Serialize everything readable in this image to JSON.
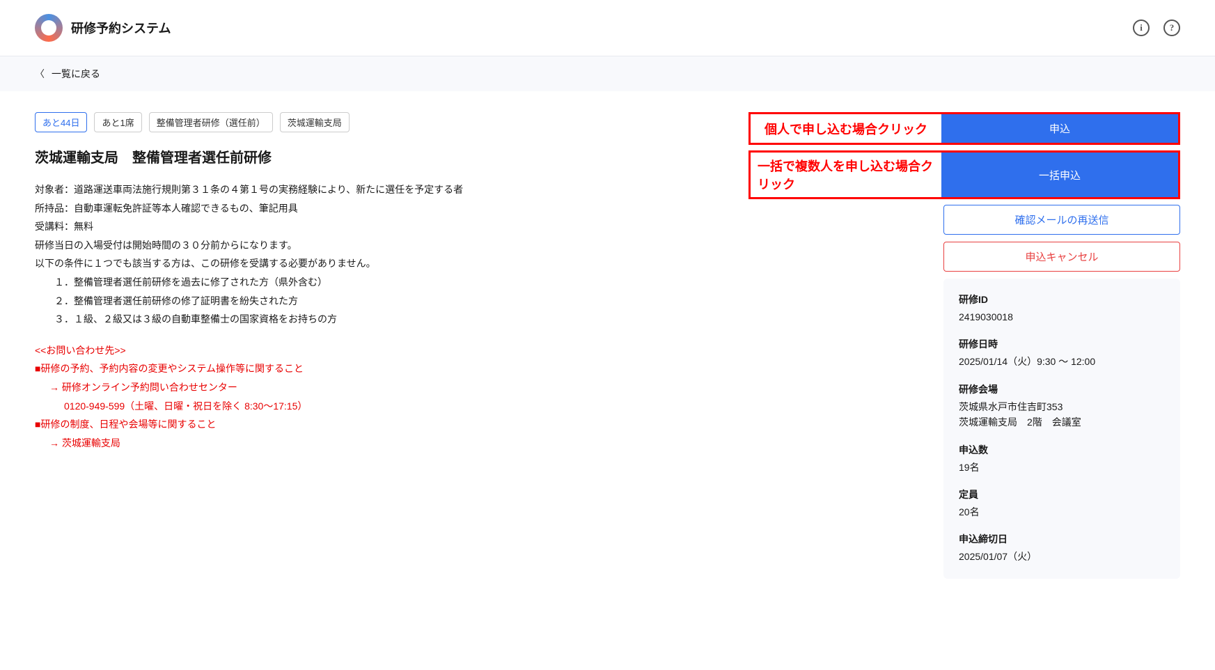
{
  "header": {
    "title": "研修予約システム"
  },
  "back": {
    "label": "一覧に戻る"
  },
  "badges": {
    "days_left": "あと44日",
    "seats_left": "あと1席",
    "category": "整備管理者研修（選任前）",
    "branch": "茨城運輸支局"
  },
  "title": "茨城運輸支局　整備管理者選任前研修",
  "desc": {
    "line1": "対象者：道路運送車両法施行規則第３１条の４第１号の実務経験により、新たに選任を予定する者",
    "line2": "所持品：自動車運転免許証等本人確認できるもの、筆記用具",
    "line3": "受講料：無料",
    "line4": "研修当日の入場受付は開始時間の３０分前からになります。",
    "line5": "以下の条件に１つでも該当する方は、この研修を受講する必要がありません。",
    "item1": "１．整備管理者選任前研修を過去に修了された方（県外含む）",
    "item2": "２．整備管理者選任前研修の修了証明書を紛失された方",
    "item3": "３．１級、２級又は３級の自動車整備士の国家資格をお持ちの方"
  },
  "contact": {
    "header": "<<お問い合わせ先>>",
    "sec1": "■研修の予約、予約内容の変更やシステム操作等に関すること",
    "sec1_line1": "→ 研修オンライン予約問い合わせセンター",
    "sec1_line2": "0120-949-599（土曜、日曜・祝日を除く 8:30〜17:15）",
    "sec2": "■研修の制度、日程や会場等に関すること",
    "sec2_line1": "→ 茨城運輸支局"
  },
  "actions": {
    "apply_annot": "個人で申し込む場合クリック",
    "apply_label": "申込",
    "bulk_annot": "一括で複数人を申し込む場合クリック",
    "bulk_label": "一括申込",
    "resend_label": "確認メールの再送信",
    "cancel_label": "申込キャンセル"
  },
  "info": {
    "id_label": "研修ID",
    "id_value": "2419030018",
    "datetime_label": "研修日時",
    "datetime_value": "2025/01/14（火）9:30 〜 12:00",
    "venue_label": "研修会場",
    "venue_addr": "茨城県水戸市住吉町353",
    "venue_name": "茨城運輸支局　2階　会議室",
    "applied_label": "申込数",
    "applied_value": "19名",
    "capacity_label": "定員",
    "capacity_value": "20名",
    "deadline_label": "申込締切日",
    "deadline_value": "2025/01/07（火）"
  }
}
